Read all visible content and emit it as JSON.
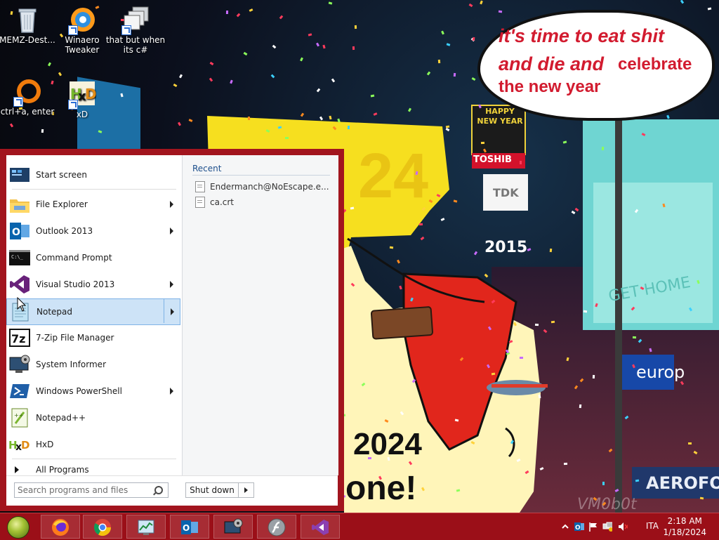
{
  "desktop": {
    "icons": [
      {
        "label": "MEMZ-Dest...",
        "icon": "recycle-bin-icon"
      },
      {
        "label": "Winaero Tweaker",
        "icon": "winaero-icon"
      },
      {
        "label": "that but when its c#",
        "icon": "stack-windows-icon"
      },
      {
        "label": "ctrl+a, enter",
        "icon": "ring-icon"
      },
      {
        "label": "xD",
        "icon": "hxd-icon"
      }
    ]
  },
  "wallpaper": {
    "bubble_line1": "it's time to eat shit",
    "bubble_line2": "and die and",
    "bubble_line3": "celebrate",
    "bubble_line4": "the new year",
    "banner_year": "2024",
    "banner_bottom": "one!",
    "sign_happy": "HAPPY NEW YEAR",
    "sign_tdk": "TDK",
    "sign_2015": "2015",
    "sign_get_home": "GET HOME",
    "sign_europe": "europ",
    "sign_aero": "AEROFOS",
    "sign_toshiba": "TOSHIB",
    "watermark": "VM0b0t",
    "hat_number": "24"
  },
  "start_menu": {
    "items": [
      {
        "label": "Start screen",
        "icon": "start-screen-icon",
        "submenu": false
      },
      {
        "label": "File Explorer",
        "icon": "file-explorer-icon",
        "submenu": true
      },
      {
        "label": "Outlook 2013",
        "icon": "outlook-icon",
        "submenu": true
      },
      {
        "label": "Command Prompt",
        "icon": "command-prompt-icon",
        "submenu": false
      },
      {
        "label": "Visual Studio 2013",
        "icon": "visual-studio-icon",
        "submenu": true
      },
      {
        "label": "Notepad",
        "icon": "notepad-icon",
        "submenu": true
      },
      {
        "label": "7-Zip File Manager",
        "icon": "seven-zip-icon",
        "submenu": false
      },
      {
        "label": "System Informer",
        "icon": "system-informer-icon",
        "submenu": false
      },
      {
        "label": "Windows PowerShell",
        "icon": "powershell-icon",
        "submenu": true
      },
      {
        "label": "Notepad++",
        "icon": "notepadpp-icon",
        "submenu": false
      },
      {
        "label": "HxD",
        "icon": "hxd-icon",
        "submenu": false
      }
    ],
    "all_programs": "All Programs",
    "recent_title": "Recent",
    "recent_items": [
      "Endermanch@NoEscape.e...",
      "ca.crt"
    ],
    "search_placeholder": "Search programs and files",
    "shutdown_label": "Shut down"
  },
  "taskbar": {
    "pinned": [
      "firefox-icon",
      "chrome-icon",
      "task-manager-icon",
      "outlook-icon",
      "system-informer-icon",
      "flash-icon",
      "visual-studio-icon"
    ],
    "tray_icons": [
      "show-hidden-icon",
      "outlook-icon",
      "flag-icon",
      "network-icon",
      "volume-muted-icon"
    ],
    "language": "ITA",
    "time": "2:18 AM",
    "date": "1/18/2024"
  },
  "colors": {
    "start_menu_frame": "#a2151e",
    "taskbar": "#9b0f18",
    "highlight": "#cde3f7",
    "bubble_text": "#d21b2f"
  }
}
